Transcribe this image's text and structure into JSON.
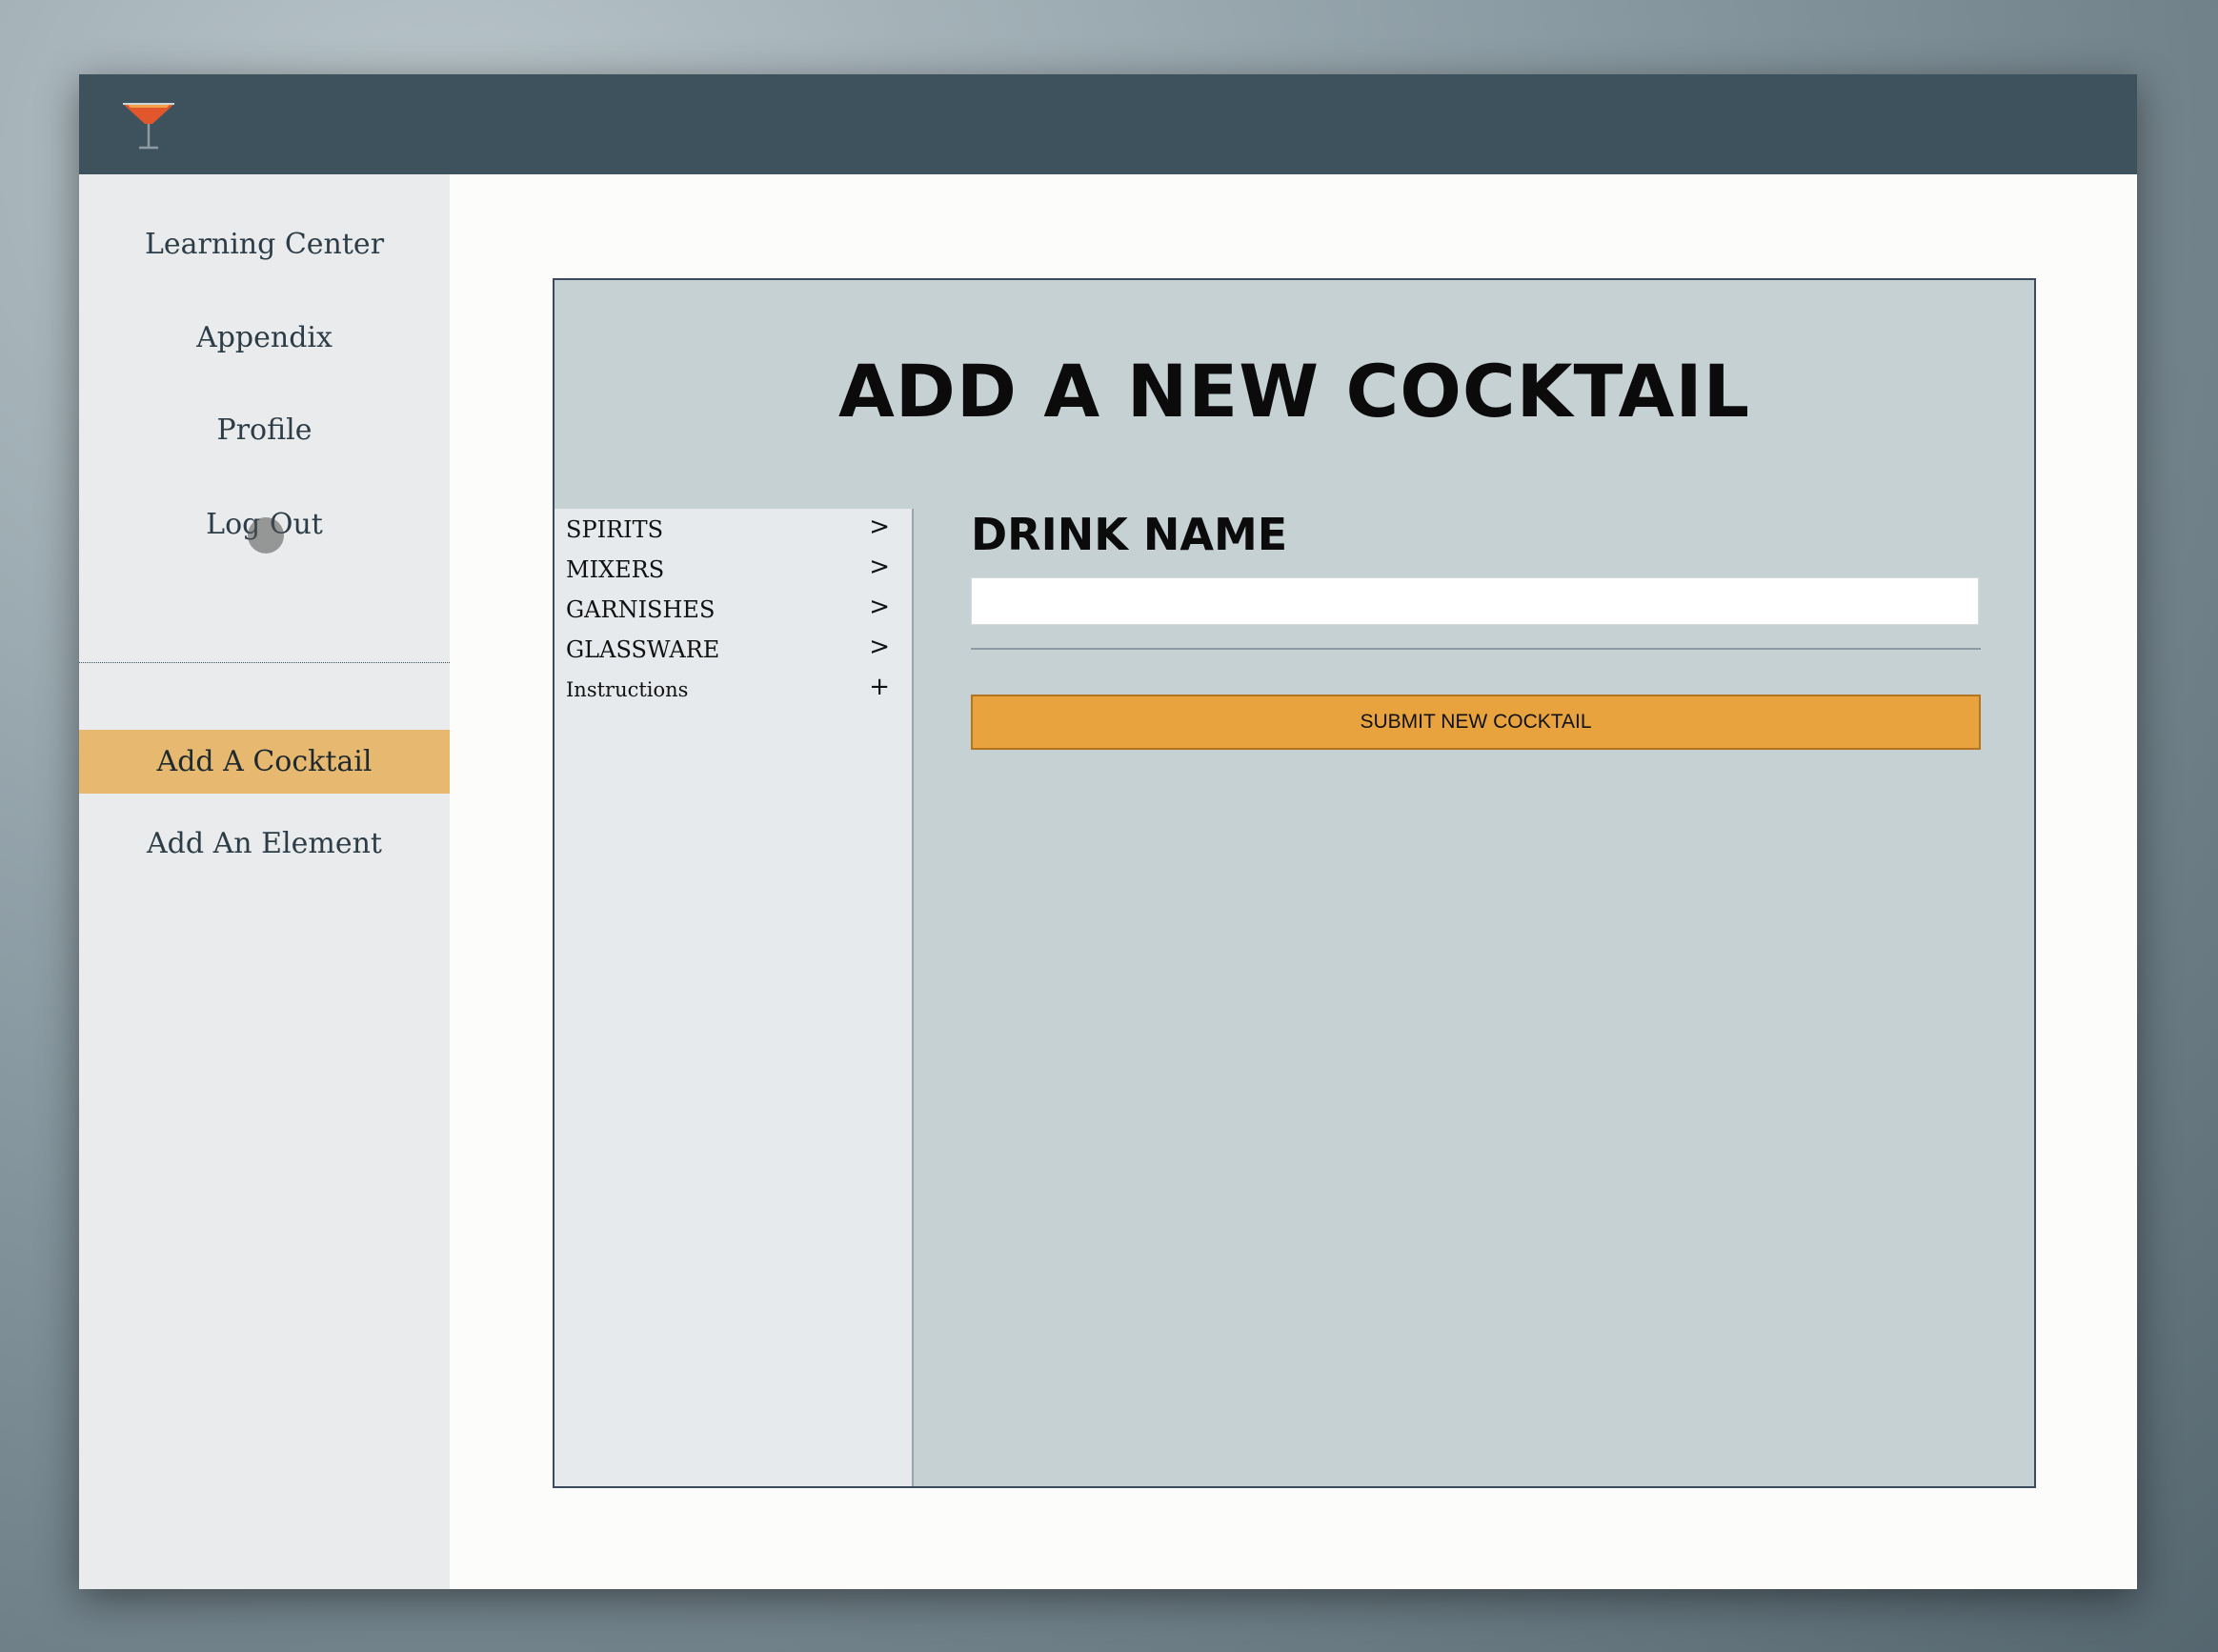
{
  "app": {
    "logo_icon": "cocktail-glass-icon",
    "accent_color": "#e8a33f",
    "topbar_color": "#3e525d"
  },
  "sidebar": {
    "items": [
      {
        "label": "Learning Center"
      },
      {
        "label": "Appendix"
      },
      {
        "label": "Profile"
      },
      {
        "label": "Log Out"
      },
      {
        "label": "Add A Cocktail",
        "active": true
      },
      {
        "label": "Add An Element"
      }
    ]
  },
  "main": {
    "title": "ADD A NEW COCKTAIL",
    "elements": [
      {
        "label": "SPIRITS",
        "icon": "chevron-right-icon",
        "symbol": ">"
      },
      {
        "label": "MIXERS",
        "icon": "chevron-right-icon",
        "symbol": ">"
      },
      {
        "label": "GARNISHES",
        "icon": "chevron-right-icon",
        "symbol": ">"
      },
      {
        "label": "GLASSWARE",
        "icon": "chevron-right-icon",
        "symbol": ">"
      },
      {
        "label": "Instructions",
        "icon": "plus-icon",
        "symbol": "+"
      }
    ],
    "form": {
      "drink_name_label": "DRINK NAME",
      "drink_name_value": "",
      "drink_name_placeholder": "",
      "submit_label": "SUBMIT NEW COCKTAIL"
    }
  }
}
